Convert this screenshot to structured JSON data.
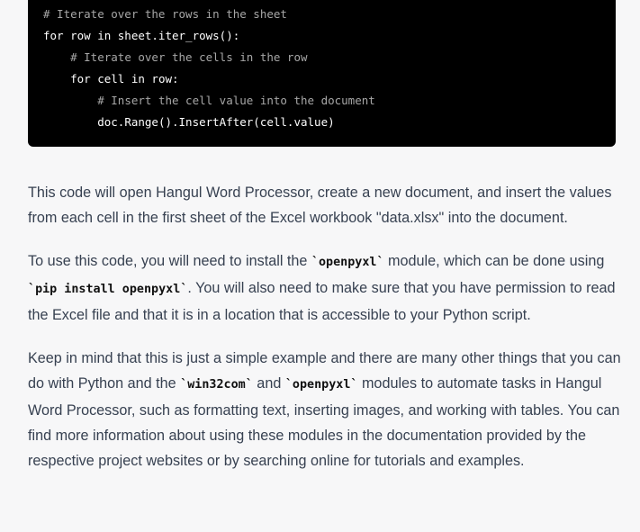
{
  "code_block": {
    "lines": [
      {
        "indent": "",
        "text": "# Iterate over the rows in the sheet",
        "comment": true
      },
      {
        "indent": "",
        "text": "for row in sheet.iter_rows():",
        "comment": false
      },
      {
        "indent": "    ",
        "text": "# Iterate over the cells in the row",
        "comment": true
      },
      {
        "indent": "    ",
        "text": "for cell in row:",
        "comment": false
      },
      {
        "indent": "        ",
        "text": "# Insert the cell value into the document",
        "comment": true
      },
      {
        "indent": "        ",
        "text": "doc.Range().InsertAfter(cell.value)",
        "comment": false
      }
    ]
  },
  "paragraphs": [
    {
      "parts": [
        {
          "text": "This code will open Hangul Word Processor, create a new document, and insert the values from each cell in the first sheet of the Excel workbook \"data.xlsx\" into the document.",
          "code": false
        }
      ]
    },
    {
      "parts": [
        {
          "text": "To use this code, you will need to install the ",
          "code": false
        },
        {
          "text": "openpyxl",
          "code": true
        },
        {
          "text": " module, which can be done using ",
          "code": false
        },
        {
          "text": "pip install openpyxl",
          "code": true
        },
        {
          "text": ". You will also need to make sure that you have permission to read the Excel file and that it is in a location that is accessible to your Python script.",
          "code": false
        }
      ]
    },
    {
      "parts": [
        {
          "text": "Keep in mind that this is just a simple example and there are many other things that you can do with Python and the ",
          "code": false
        },
        {
          "text": "win32com",
          "code": true
        },
        {
          "text": " and ",
          "code": false
        },
        {
          "text": "openpyxl",
          "code": true
        },
        {
          "text": " modules to automate tasks in Hangul Word Processor, such as formatting text, inserting images, and working with tables. You can find more information about using these modules in the documentation provided by the respective project websites or by searching online for tutorials and examples.",
          "code": false
        }
      ]
    }
  ]
}
